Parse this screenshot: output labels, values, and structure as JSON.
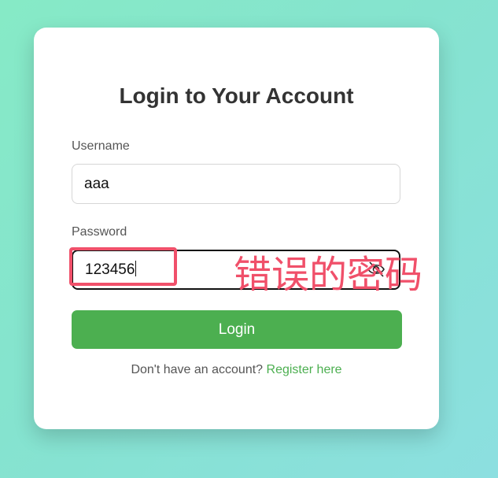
{
  "form": {
    "title": "Login to Your Account",
    "username_label": "Username",
    "username_value": "aaa",
    "password_label": "Password",
    "password_value": "123456",
    "login_button": "Login",
    "footer_text": "Don't have an account?",
    "register_link": "Register here"
  },
  "annotation": {
    "text": "错误的密码",
    "color": "#f0506a"
  },
  "colors": {
    "accent": "#4caf50",
    "card": "#ffffff"
  }
}
